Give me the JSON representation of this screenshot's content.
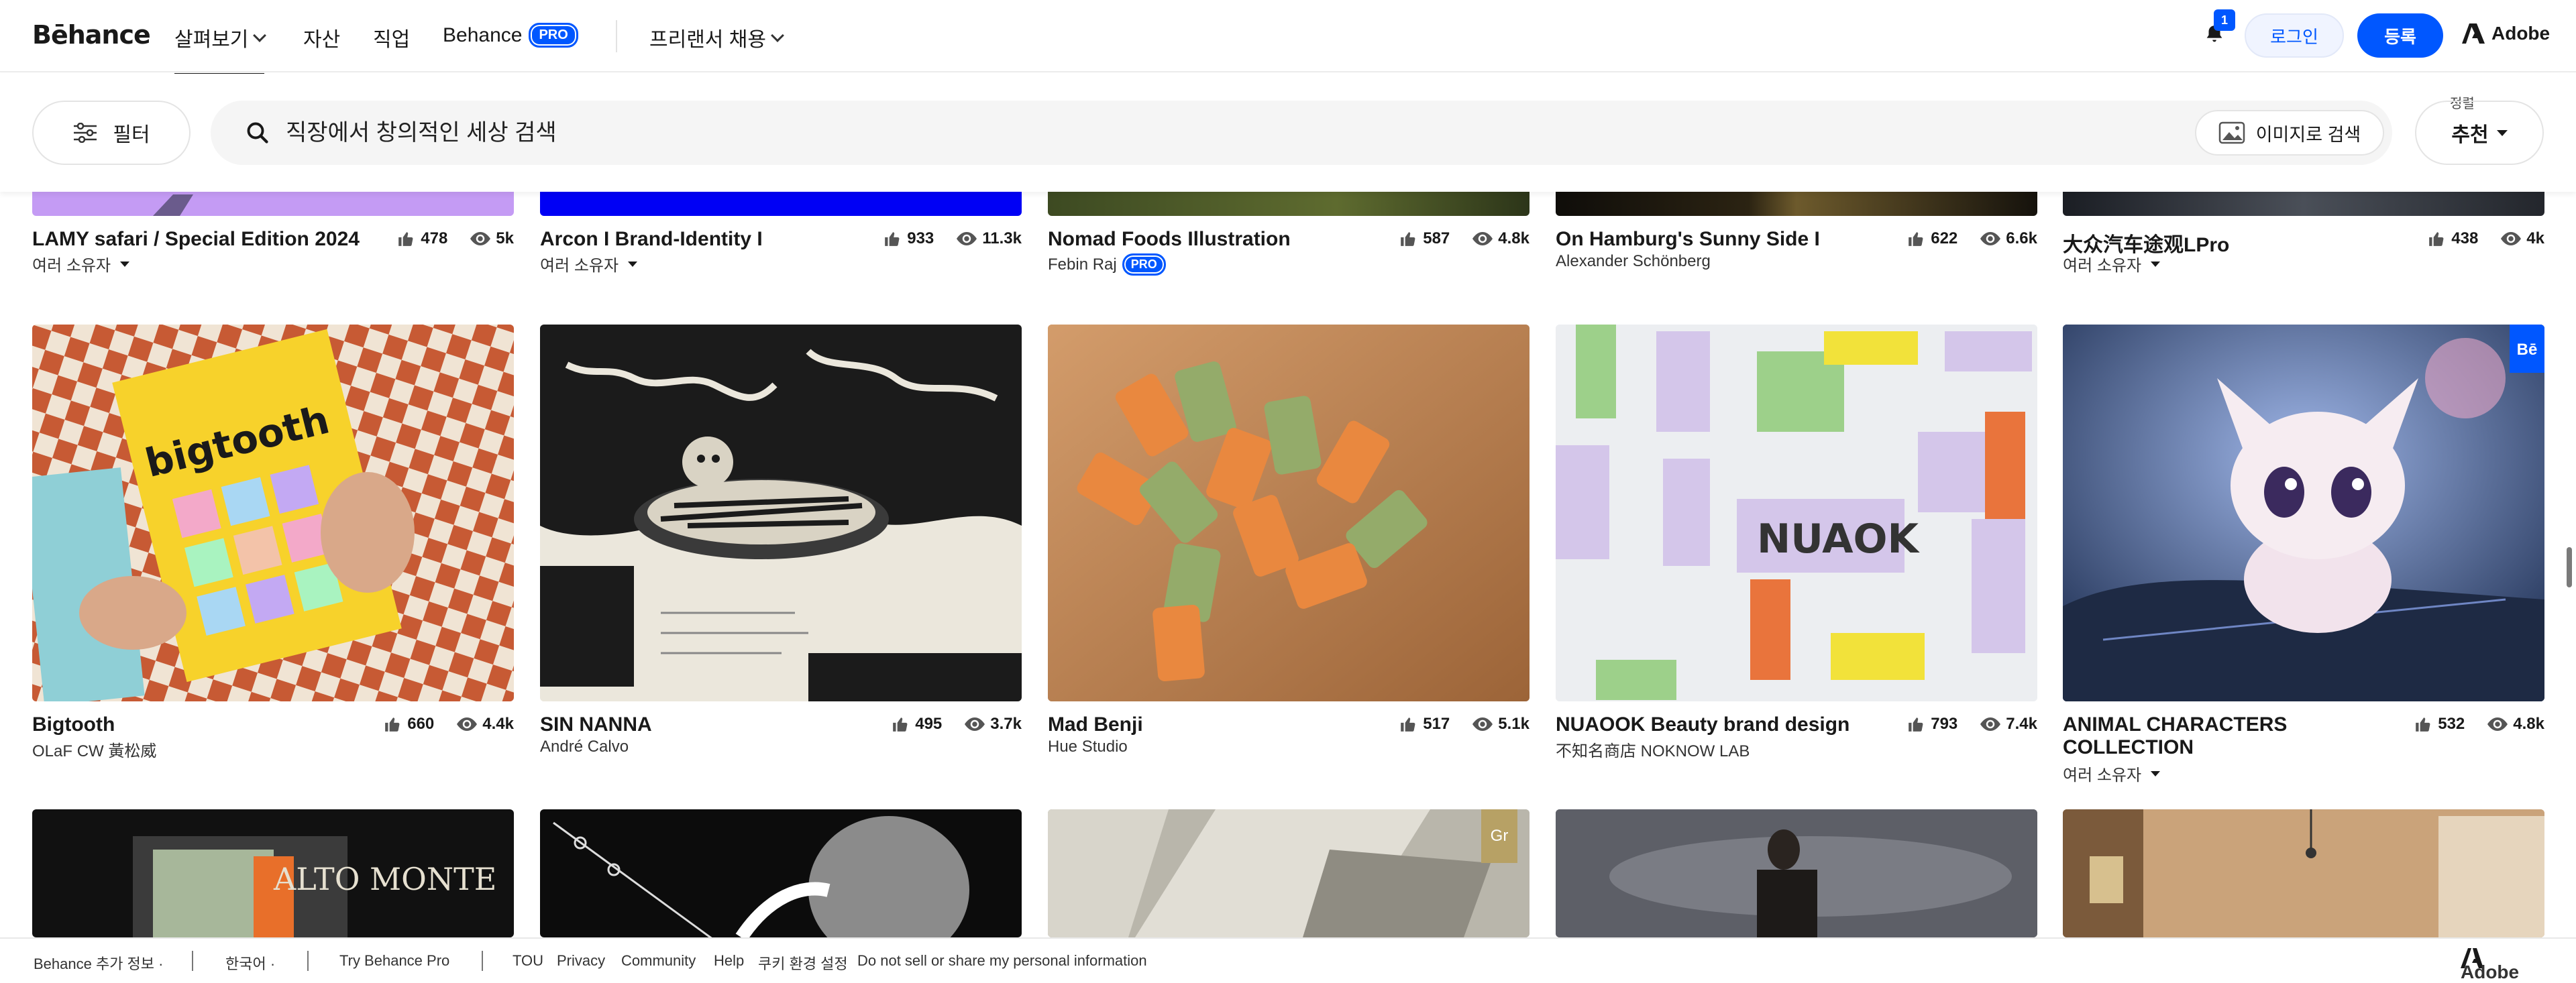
{
  "nav": {
    "logo": "Bēhance",
    "items": [
      {
        "label": "살펴보기"
      },
      {
        "label": "자산"
      },
      {
        "label": "직업"
      },
      {
        "label": "Behance"
      }
    ],
    "pro_badge": "PRO",
    "hire_label": "프리랜서 채용",
    "notification_count": "1",
    "login_label": "로그인",
    "signup_label": "등록",
    "adobe_label": "Adobe"
  },
  "toolbar": {
    "filter_label": "필터",
    "search_placeholder": "직장에서 창의적인 세상 검색",
    "image_search_label": "이미지로 검색",
    "sort_caption": "정렬",
    "sort_value": "추천"
  },
  "projects": [
    {
      "title": "LAMY safari / Special Edition 2024",
      "owner": "여러 소유자",
      "owner_dropdown": true,
      "likes": "478",
      "views": "5k"
    },
    {
      "title": "Arcon I Brand-Identity I",
      "owner": "여러 소유자",
      "owner_dropdown": true,
      "likes": "933",
      "views": "11.3k"
    },
    {
      "title": "Nomad Foods Illustration",
      "owner": "Febin Raj",
      "owner_pro": "PRO",
      "likes": "587",
      "views": "4.8k"
    },
    {
      "title": "On Hamburg's Sunny Side I",
      "owner": "Alexander Schönberg",
      "likes": "622",
      "views": "6.6k"
    },
    {
      "title": "大众汽车途观LPro",
      "owner": "여러 소유자",
      "owner_dropdown": true,
      "likes": "438",
      "views": "4k"
    },
    {
      "title": "Bigtooth",
      "owner": "OLaF CW 黃松威",
      "likes": "660",
      "views": "4.4k"
    },
    {
      "title": "SIN NANNA",
      "owner": "André Calvo",
      "likes": "495",
      "views": "3.7k"
    },
    {
      "title": "Mad Benji",
      "owner": "Hue Studio",
      "likes": "517",
      "views": "5.1k"
    },
    {
      "title": "NUAOOK Beauty brand design",
      "owner": "不知名商店 NOKNOW LAB",
      "likes": "793",
      "views": "7.4k"
    },
    {
      "title": "ANIMAL CHARACTERS",
      "title_line2": "COLLECTION",
      "owner": "여러 소유자",
      "owner_dropdown": true,
      "likes": "532",
      "views": "4.8k",
      "badge": "Bē"
    }
  ],
  "row3_badges": {
    "gr": "Gr"
  },
  "footer": {
    "more_info": "Behance 추가 정보",
    "language": "한국어",
    "try_pro": "Try Behance Pro",
    "links": [
      "TOU",
      "Privacy",
      "Community",
      "Help",
      "쿠키 환경 설정",
      "Do not sell or share my personal information"
    ],
    "adobe_label": "Adobe"
  },
  "colors": {
    "accent": "#0057ff",
    "text": "#191919"
  }
}
